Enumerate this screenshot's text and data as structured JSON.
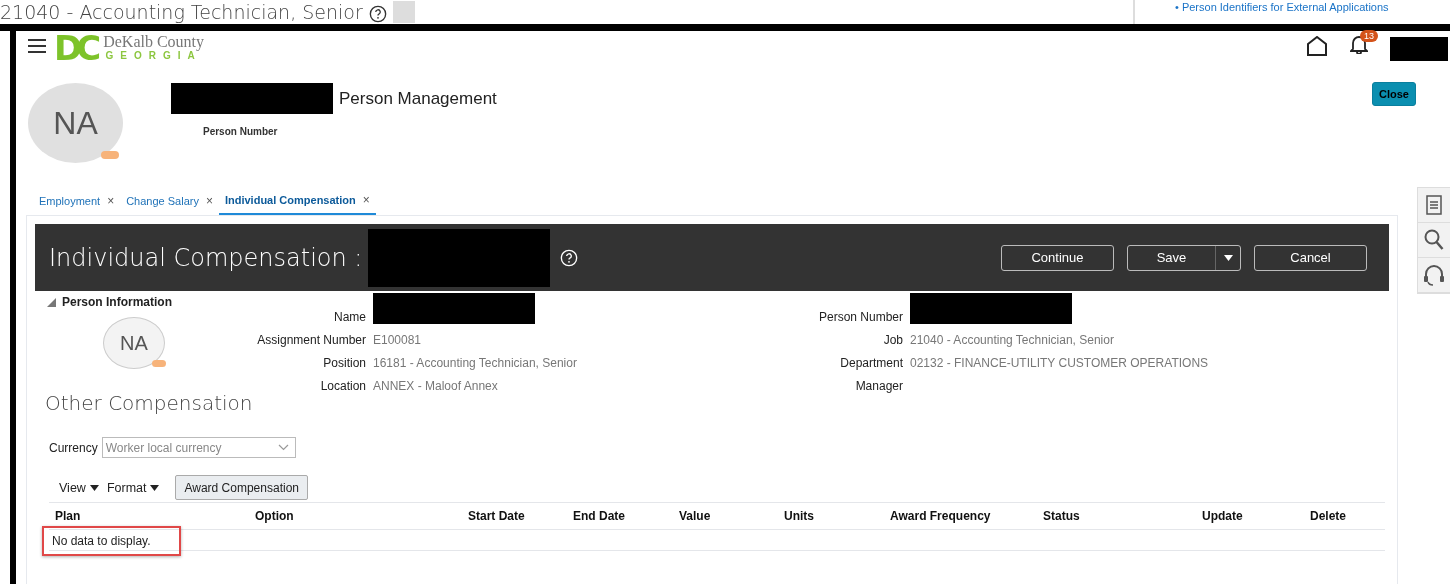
{
  "window": {
    "title": "21040 - Accounting Technician, Senior"
  },
  "side_link": "• Person Identifiers for External Applications",
  "logo": {
    "mark": "DC",
    "name": "DeKalb County",
    "region": "GEORGIA"
  },
  "notifications": {
    "count": "13"
  },
  "person": {
    "initials": "NA",
    "name_redacted": true,
    "title": "Person Management",
    "number_label": "Person Number"
  },
  "close_button": "Close",
  "tabs": [
    {
      "label": "Employment",
      "close": "×",
      "selected": false
    },
    {
      "label": "Change Salary",
      "close": "×",
      "selected": false
    },
    {
      "label": "Individual Compensation",
      "close": "×",
      "selected": true
    }
  ],
  "page": {
    "title": "Individual Compensation :",
    "name_redacted": true,
    "buttons": [
      {
        "label": "Continue",
        "kind": "plain"
      },
      {
        "label": "Save",
        "kind": "split"
      },
      {
        "label": "Cancel",
        "kind": "plain"
      }
    ]
  },
  "person_info": {
    "heading": "Person Information",
    "expanded": true,
    "initials": "NA",
    "fields_left": [
      {
        "label": "Name",
        "redacted": true
      },
      {
        "label": "Assignment Number",
        "value": "E100081"
      },
      {
        "label": "Position",
        "value": "16181 - Accounting Technician, Senior"
      },
      {
        "label": "Location",
        "value": "ANNEX - Maloof Annex"
      }
    ],
    "fields_right": [
      {
        "label": "Person Number",
        "redacted": true
      },
      {
        "label": "Job",
        "value": "21040 - Accounting Technician, Senior"
      },
      {
        "label": "Department",
        "value": "02132 - FINANCE-UTILITY CUSTOMER OPERATIONS"
      },
      {
        "label": "Manager"
      }
    ]
  },
  "other_compensation": {
    "heading": "Other Compensation",
    "currency": {
      "label": "Currency",
      "value": "Worker local currency"
    },
    "menus": [
      "View",
      "Format"
    ],
    "award_button": "Award Compensation",
    "table": {
      "columns": [
        "Plan",
        "Option",
        "Start Date",
        "End Date",
        "Value",
        "Units",
        "Award Frequency",
        "Status",
        "Update",
        "Delete"
      ],
      "empty_message": "No data to display.",
      "empty_highlighted": true
    }
  }
}
